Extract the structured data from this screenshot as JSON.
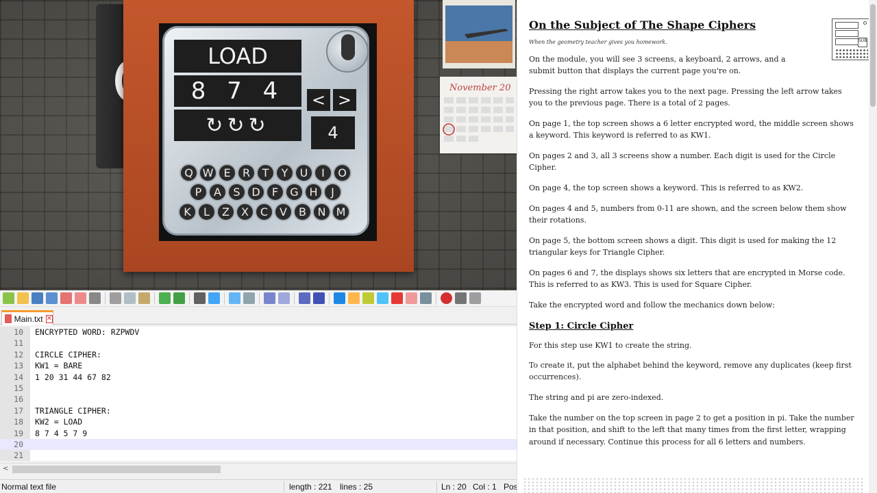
{
  "game": {
    "top_screen": "LOAD",
    "middle_screen": "8 7 4",
    "bottom_screen": "↻↻↻",
    "left_arrow": "<",
    "right_arrow": ">",
    "submit_page": "4",
    "keyboard": {
      "row1": [
        "Q",
        "W",
        "E",
        "R",
        "T",
        "Y",
        "U",
        "I",
        "O"
      ],
      "row2": [
        "P",
        "A",
        "S",
        "D",
        "F",
        "G",
        "H",
        "J"
      ],
      "row3": [
        "K",
        "L",
        "Z",
        "X",
        "C",
        "V",
        "B",
        "N",
        "M"
      ]
    }
  },
  "editor": {
    "tab_label": "Main.txt",
    "tab_close": "✕",
    "lines": [
      {
        "num": "10",
        "text": "ENCRYPTED WORD: RZPWDV"
      },
      {
        "num": "11",
        "text": ""
      },
      {
        "num": "12",
        "text": "CIRCLE CIPHER:"
      },
      {
        "num": "13",
        "text": "KW1 = BARE"
      },
      {
        "num": "14",
        "text": "1 20 31 44 67 82"
      },
      {
        "num": "15",
        "text": ""
      },
      {
        "num": "16",
        "text": ""
      },
      {
        "num": "17",
        "text": "TRIANGLE CIPHER:"
      },
      {
        "num": "18",
        "text": "KW2 = LOAD"
      },
      {
        "num": "19",
        "text": "8 7 4 5 7 9"
      },
      {
        "num": "20",
        "text": ""
      },
      {
        "num": "21",
        "text": ""
      }
    ],
    "current_line_index": 10,
    "scroll_left": "<",
    "status": {
      "file_type": "Normal text file",
      "length": "length : 221",
      "lines": "lines : 25",
      "ln": "Ln : 20",
      "col": "Col : 1",
      "pos": "Pos"
    }
  },
  "manual": {
    "title": "On the Subject of The Shape Ciphers",
    "subtitle": "When the geometry teacher gives you homework.",
    "icon_sub": "SUB",
    "paragraphs": [
      "On the module, you will see 3 screens, a keyboard, 2 arrows, and a submit button that displays the current page you're on.",
      "Pressing the right arrow takes you to the next page. Pressing the left arrow takes you to the previous page. There is a total of 2 pages.",
      "On page 1, the top screen shows a 6 letter encrypted word, the middle screen shows a keyword. This keyword is referred to as KW1.",
      "On pages 2 and 3, all 3 screens show a number. Each digit is used for the Circle Cipher.",
      "On page 4, the top screen shows a keyword. This is referred to as KW2.",
      "On pages 4 and 5, numbers from 0-11 are shown, and the screen below them show their rotations.",
      "On page 5, the bottom screen shows a digit. This digit is used for making the 12 triangular keys for Triangle Cipher.",
      "On pages 6 and 7, the displays shows six letters that are encrypted in Morse code. This is referred to as KW3. This is used for Square Cipher.",
      "Take the encrypted word and follow the mechanics down below:"
    ],
    "step1_heading": "Step 1: Circle Cipher",
    "step1_paragraphs": [
      "For this step use KW1 to create the string.",
      "To create it, put the alphabet behind the keyword, remove any duplicates (keep first occurrences).",
      "The string and pi are zero-indexed.",
      "Take the number on the top screen in page 2 to get a position in pi. Take the number in that position, and shift to the left that many times from the first letter, wrapping around if necessary. Continue this process for all 6 letters and numbers."
    ]
  }
}
